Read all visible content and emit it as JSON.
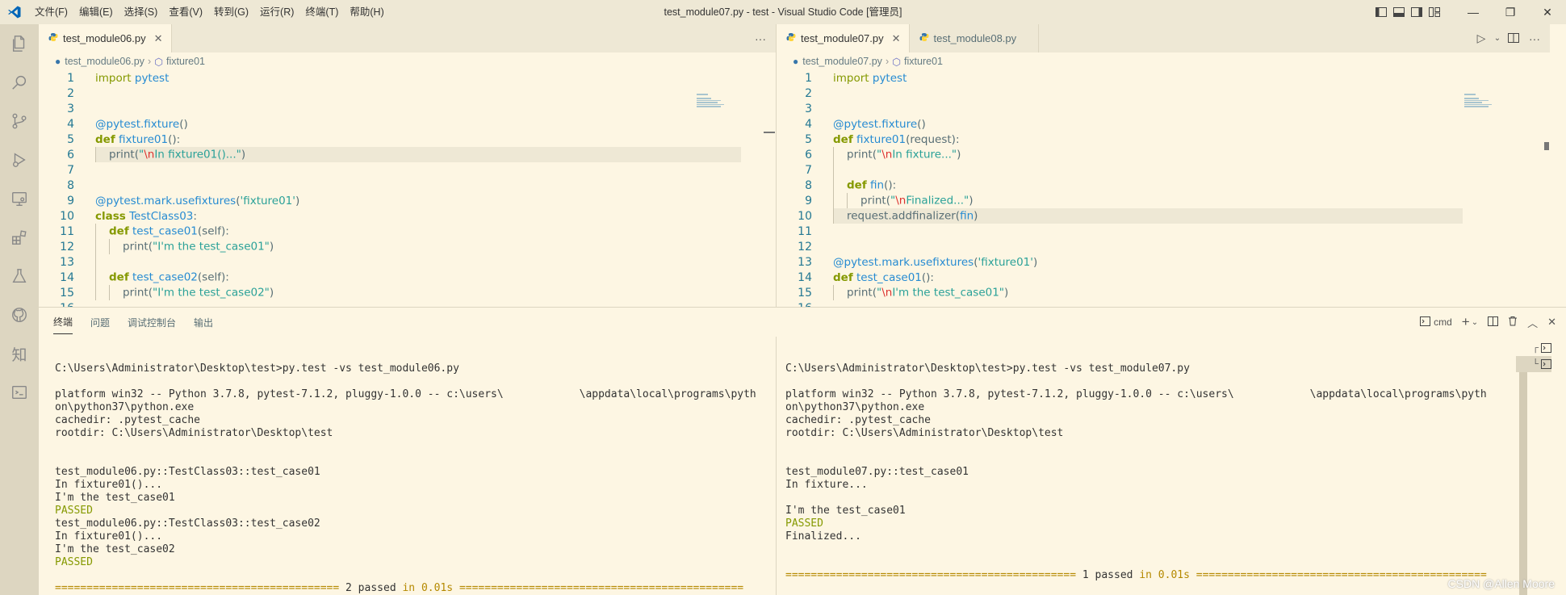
{
  "titlebar": {
    "menu": [
      "文件(F)",
      "编辑(E)",
      "选择(S)",
      "查看(V)",
      "转到(G)",
      "运行(R)",
      "终端(T)",
      "帮助(H)"
    ],
    "title": "test_module07.py - test - Visual Studio Code [管理员]",
    "minimize": "—",
    "restore": "❐",
    "close": "✕"
  },
  "activitybar": {
    "icons": [
      "files-icon",
      "search-icon",
      "source-control-icon",
      "run-debug-icon",
      "remote-explorer-icon",
      "extensions-icon",
      "testing-icon",
      "github-icon",
      "zhi-icon",
      "terminal-icon"
    ]
  },
  "editor_left": {
    "tabs": [
      {
        "label": "test_module06.py",
        "active": true
      }
    ],
    "breadcrumb": {
      "file": "test_module06.py",
      "symbol": "fixture01"
    },
    "more": "···"
  },
  "editor_right": {
    "tabs": [
      {
        "label": "test_module07.py",
        "active": true
      },
      {
        "label": "test_module08.py",
        "active": false
      }
    ],
    "breadcrumb": {
      "file": "test_module07.py",
      "symbol": "fixture01"
    },
    "more": "···"
  },
  "panel": {
    "tabs": [
      "终端",
      "问题",
      "调试控制台",
      "输出"
    ],
    "shell": "cmd",
    "terminal_left": {
      "prompt": "C:\\Users\\Administrator\\Desktop\\test>py.test -vs test_module06.py",
      "platform1": "platform win32 -- Python 3.7.8, pytest-7.1.2, pluggy-1.0.0 -- c:\\users\\            \\appdata\\local\\programs\\pyth",
      "platform2": "on\\python37\\python.exe",
      "cachedir": "cachedir: .pytest_cache",
      "rootdir": "rootdir: C:\\Users\\Administrator\\Desktop\\test",
      "lines": [
        "test_module06.py::TestClass03::test_case01",
        "In fixture01()...",
        "I'm the test_case01",
        "PASSED",
        "test_module06.py::TestClass03::test_case02",
        "In fixture01()...",
        "I'm the test_case02",
        "PASSED"
      ],
      "summary_count": "2 passed",
      "summary_time": "in 0.01s"
    },
    "terminal_right": {
      "prompt": "C:\\Users\\Administrator\\Desktop\\test>py.test -vs test_module07.py",
      "platform1": "platform win32 -- Python 3.7.8, pytest-7.1.2, pluggy-1.0.0 -- c:\\users\\            \\appdata\\local\\programs\\pyth",
      "platform2": "on\\python37\\python.exe",
      "cachedir": "cachedir: .pytest_cache",
      "rootdir": "rootdir: C:\\Users\\Administrator\\Desktop\\test",
      "lines": [
        "test_module07.py::test_case01",
        "In fixture...",
        "",
        "I'm the test_case01",
        "PASSED",
        "Finalized..."
      ],
      "summary_count": "1 passed",
      "summary_time": "in 0.01s"
    }
  },
  "watermark": "CSDN @Allen Moore",
  "colors": {
    "background": "#fdf6e3",
    "sidebar": "#eee8d5",
    "accent": "#268bd2",
    "pass": "#859900"
  }
}
